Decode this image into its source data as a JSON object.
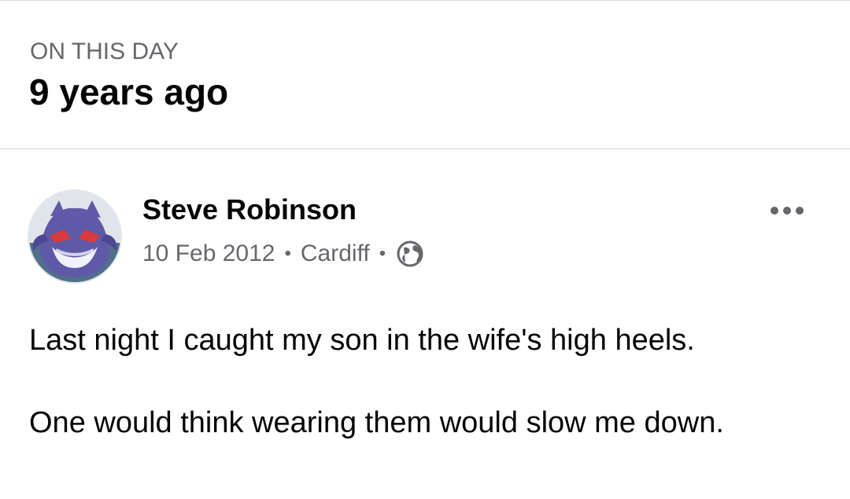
{
  "memory": {
    "kicker": "ON THIS DAY",
    "title": "9 years ago"
  },
  "post": {
    "author": "Steve Robinson",
    "date": "10 Feb 2012",
    "separator": "•",
    "location": "Cardiff",
    "privacy_icon": "globe-icon",
    "more_icon": "more-options-icon",
    "avatar_icon": "profile-avatar",
    "text_lines": [
      "Last night I caught my son in the wife's high heels.",
      "One would think wearing them would slow me down."
    ]
  },
  "colors": {
    "primary_text": "#050505",
    "secondary_text": "#65676b",
    "divider": "#ced0d4",
    "avatar_purple": "#5f5aa8"
  }
}
